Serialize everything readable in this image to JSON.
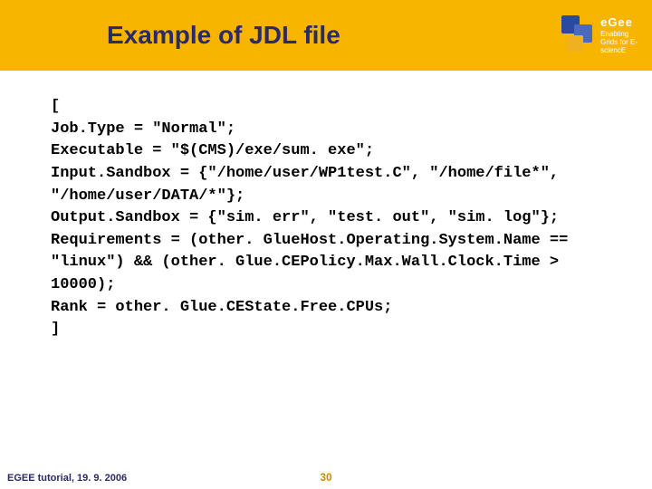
{
  "header": {
    "title": "Example of JDL file",
    "logo": {
      "brand": "eGee",
      "tagline": "Enabling Grids for E-sciencE"
    }
  },
  "code": {
    "lines": [
      "[",
      "Job.Type = \"Normal\";",
      "Executable = \"$(CMS)/exe/sum. exe\";",
      "Input.Sandbox = {\"/home/user/WP1test.C\", \"/home/file*\", \"/home/user/DATA/*\"};",
      "Output.Sandbox = {\"sim. err\", \"test. out\", \"sim. log\"};",
      "Requirements  = (other. GlueHost.Operating.System.Name == \"linux\") && (other. Glue.CEPolicy.Max.Wall.Clock.Time > 10000);",
      "Rank = other. Glue.CEState.Free.CPUs;",
      "]"
    ]
  },
  "footer": {
    "left": "EGEE tutorial, 19. 9. 2006",
    "center": "30"
  }
}
